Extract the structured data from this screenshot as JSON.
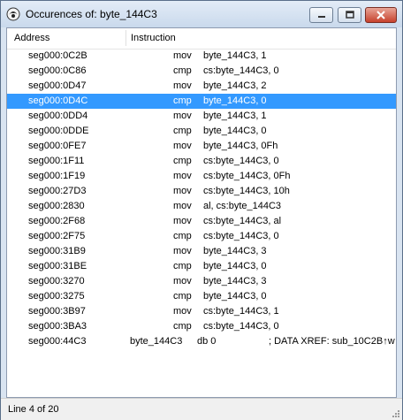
{
  "window": {
    "title": "Occurences of: byte_144C3"
  },
  "columns": {
    "address": "Address",
    "instruction": "Instruction"
  },
  "rows": [
    {
      "addr": "seg000:0C2B",
      "mn": "mov",
      "op": "byte_144C3, 1"
    },
    {
      "addr": "seg000:0C86",
      "mn": "cmp",
      "op": "cs:byte_144C3, 0"
    },
    {
      "addr": "seg000:0D47",
      "mn": "mov",
      "op": "byte_144C3, 2"
    },
    {
      "addr": "seg000:0D4C",
      "mn": "cmp",
      "op": "byte_144C3, 0"
    },
    {
      "addr": "seg000:0DD4",
      "mn": "mov",
      "op": "byte_144C3, 1"
    },
    {
      "addr": "seg000:0DDE",
      "mn": "cmp",
      "op": "byte_144C3, 0"
    },
    {
      "addr": "seg000:0FE7",
      "mn": "mov",
      "op": "byte_144C3, 0Fh"
    },
    {
      "addr": "seg000:1F11",
      "mn": "cmp",
      "op": "cs:byte_144C3, 0"
    },
    {
      "addr": "seg000:1F19",
      "mn": "mov",
      "op": "cs:byte_144C3, 0Fh"
    },
    {
      "addr": "seg000:27D3",
      "mn": "mov",
      "op": "cs:byte_144C3, 10h"
    },
    {
      "addr": "seg000:2830",
      "mn": "mov",
      "op": "al, cs:byte_144C3"
    },
    {
      "addr": "seg000:2F68",
      "mn": "mov",
      "op": "cs:byte_144C3, al"
    },
    {
      "addr": "seg000:2F75",
      "mn": "cmp",
      "op": "cs:byte_144C3, 0"
    },
    {
      "addr": "seg000:31B9",
      "mn": "mov",
      "op": "byte_144C3, 3"
    },
    {
      "addr": "seg000:31BE",
      "mn": "cmp",
      "op": "byte_144C3, 0"
    },
    {
      "addr": "seg000:3270",
      "mn": "mov",
      "op": "byte_144C3, 3"
    },
    {
      "addr": "seg000:3275",
      "mn": "cmp",
      "op": "byte_144C3, 0"
    },
    {
      "addr": "seg000:3B97",
      "mn": "mov",
      "op": "cs:byte_144C3, 1"
    },
    {
      "addr": "seg000:3BA3",
      "mn": "cmp",
      "op": "cs:byte_144C3, 0"
    }
  ],
  "last_row": {
    "addr": "seg000:44C3",
    "name": "byte_144C3",
    "db": "db 0",
    "comment": "; DATA XREF: sub_10C2B↑w"
  },
  "selected_index": 3,
  "status": {
    "text": "Line 4 of 20"
  },
  "colors": {
    "selection": "#3399ff",
    "close_button": "#c7412c"
  }
}
